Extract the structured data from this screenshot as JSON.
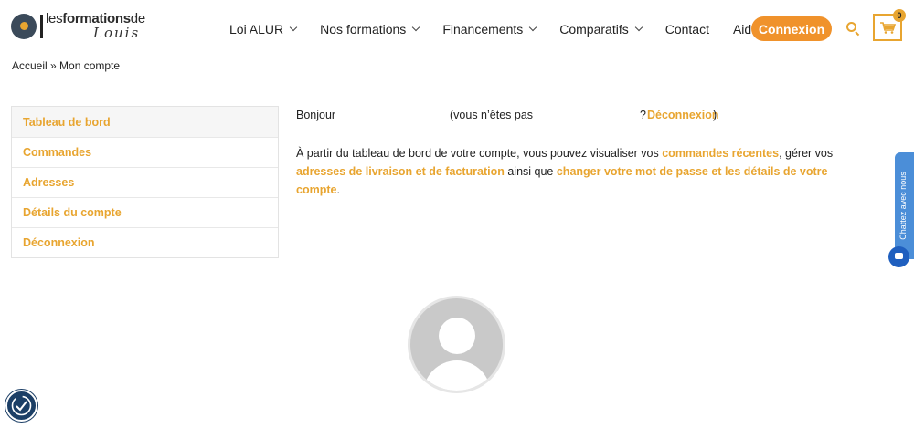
{
  "brand": {
    "line1_regular": "les",
    "line1_bold": "formations",
    "line1_end": "de",
    "line2": "Louis"
  },
  "nav": {
    "items": [
      {
        "label": "Loi ALUR",
        "has_dropdown": true
      },
      {
        "label": "Nos formations",
        "has_dropdown": true
      },
      {
        "label": "Financements",
        "has_dropdown": true
      },
      {
        "label": "Comparatifs",
        "has_dropdown": true
      },
      {
        "label": "Contact",
        "has_dropdown": false
      },
      {
        "label": "Aide",
        "has_dropdown": false
      }
    ],
    "login_label": "Connexion",
    "search_icon": "search-icon",
    "cart_icon": "cart-icon",
    "cart_count": "0"
  },
  "breadcrumb": "Accueil » Mon compte",
  "sidebar": {
    "items": [
      {
        "label": "Tableau de bord",
        "active": true
      },
      {
        "label": "Commandes",
        "active": false
      },
      {
        "label": "Adresses",
        "active": false
      },
      {
        "label": "Détails du compte",
        "active": false
      },
      {
        "label": "Déconnexion",
        "active": false
      }
    ]
  },
  "main": {
    "hello_prefix": "Bonjour",
    "hello_middle": "(vous n’êtes pas",
    "hello_question": "?",
    "hello_logout": "Déconnexion",
    "hello_close": ")",
    "para_1": "À partir du tableau de bord de votre compte, vous pouvez visualiser vos ",
    "link_orders": "commandes récentes",
    "para_2": ", gérer vos ",
    "link_addresses": "adresses de livraison et de facturation",
    "para_3": " ainsi que ",
    "link_password": "changer votre mot de passe et les détails de votre compte",
    "para_4": "."
  },
  "chat": {
    "label": "Chattez avec nous"
  },
  "colors": {
    "accent": "#e8a530",
    "button": "#f0922b",
    "chat": "#4b8ed8",
    "accessibility": "#1c3f66"
  }
}
